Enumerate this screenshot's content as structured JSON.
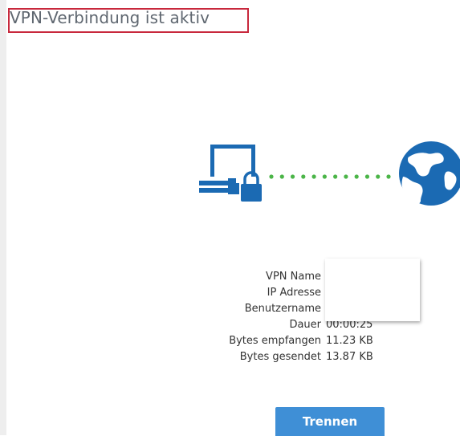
{
  "page": {
    "title": "VPN-Verbindung ist aktiv"
  },
  "graphic": {
    "icons": [
      "computer-icon",
      "lock-icon",
      "globe-icon"
    ],
    "dot_count": 12,
    "colors": {
      "icon": "#1b6ab3",
      "dots": "#4bb548"
    }
  },
  "info": {
    "rows": [
      {
        "label": "VPN Name",
        "value": ""
      },
      {
        "label": "IP Adresse",
        "value": ""
      },
      {
        "label": "Benutzername",
        "value": ""
      },
      {
        "label": "Dauer",
        "value": "00:00:25"
      },
      {
        "label": "Bytes empfangen",
        "value": "11.23 KB"
      },
      {
        "label": "Bytes gesendet",
        "value": "13.87 KB"
      }
    ]
  },
  "actions": {
    "disconnect_label": "Trennen",
    "button_color": "#3f8fd6"
  },
  "highlight_color": "#c8283c"
}
